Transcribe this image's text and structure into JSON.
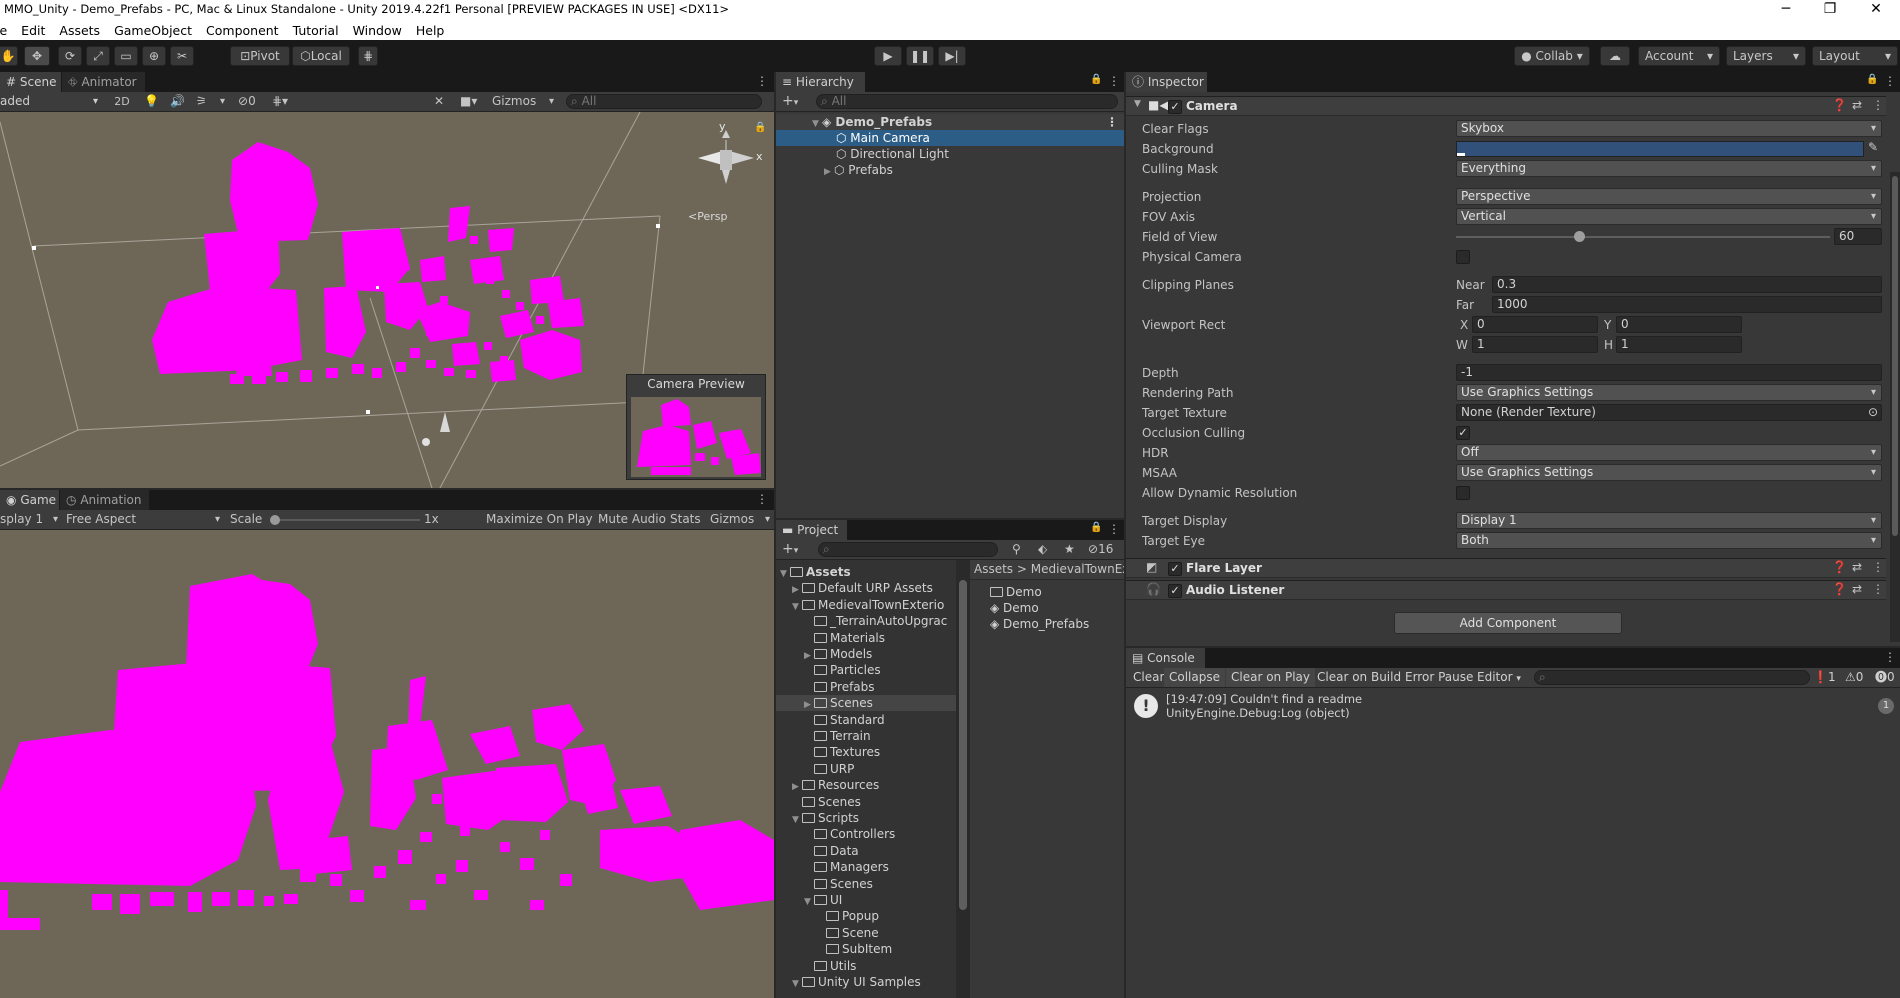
{
  "window": {
    "title": "MMO_Unity - Demo_Prefabs - PC, Mac & Linux Standalone - Unity 2019.4.22f1 Personal [PREVIEW PACKAGES IN USE] <DX11>"
  },
  "menu": [
    "le",
    "Edit",
    "Assets",
    "GameObject",
    "Component",
    "Tutorial",
    "Window",
    "Help"
  ],
  "toolbar": {
    "pivot": "Pivot",
    "local": "Local",
    "collab": "Collab",
    "account": "Account",
    "layers": "Layers",
    "layout": "Layout"
  },
  "scene": {
    "tab_scene": "Scene",
    "tab_animator": "Animator",
    "shading": "aded",
    "mode_2d": "2D",
    "hidden_count": "0",
    "gizmos": "Gizmos",
    "search_placeholder": "All",
    "axis_y": "y",
    "axis_x": "x",
    "persp": "Persp",
    "camera_preview": "Camera Preview"
  },
  "game": {
    "tab_game": "Game",
    "tab_animation": "Animation",
    "display": "splay 1",
    "aspect": "Free Aspect",
    "scale_label": "Scale",
    "scale_value": "1x",
    "maximize": "Maximize On Play",
    "mute": "Mute Audio",
    "stats": "Stats",
    "gizmos": "Gizmos"
  },
  "hierarchy": {
    "tab": "Hierarchy",
    "search_placeholder": "All",
    "scene_name": "Demo_Prefabs",
    "items": [
      "Main Camera",
      "Directional Light",
      "Prefabs"
    ]
  },
  "project": {
    "tab": "Project",
    "hidden_count": "16",
    "breadcrumb_root": "Assets",
    "breadcrumb_sep": ">",
    "breadcrumb_child": "MedievalTownExte",
    "tree": [
      {
        "label": "Assets",
        "depth": 0,
        "expanded": true,
        "bold": true
      },
      {
        "label": "Default URP Assets",
        "depth": 1,
        "expanded": false
      },
      {
        "label": "MedievalTownExterio",
        "depth": 1,
        "expanded": true
      },
      {
        "label": "_TerrainAutoUpgrac",
        "depth": 2,
        "expanded": null
      },
      {
        "label": "Materials",
        "depth": 2,
        "expanded": null
      },
      {
        "label": "Models",
        "depth": 2,
        "expanded": false
      },
      {
        "label": "Particles",
        "depth": 2,
        "expanded": null
      },
      {
        "label": "Prefabs",
        "depth": 2,
        "expanded": null
      },
      {
        "label": "Scenes",
        "depth": 2,
        "expanded": false,
        "highlight": true
      },
      {
        "label": "Standard",
        "depth": 2,
        "expanded": null
      },
      {
        "label": "Terrain",
        "depth": 2,
        "expanded": null
      },
      {
        "label": "Textures",
        "depth": 2,
        "expanded": null
      },
      {
        "label": "URP",
        "depth": 2,
        "expanded": null
      },
      {
        "label": "Resources",
        "depth": 1,
        "expanded": false
      },
      {
        "label": "Scenes",
        "depth": 1,
        "expanded": null
      },
      {
        "label": "Scripts",
        "depth": 1,
        "expanded": true
      },
      {
        "label": "Controllers",
        "depth": 2,
        "expanded": null
      },
      {
        "label": "Data",
        "depth": 2,
        "expanded": null
      },
      {
        "label": "Managers",
        "depth": 2,
        "expanded": null
      },
      {
        "label": "Scenes",
        "depth": 2,
        "expanded": null
      },
      {
        "label": "UI",
        "depth": 2,
        "expanded": true
      },
      {
        "label": "Popup",
        "depth": 3,
        "expanded": null
      },
      {
        "label": "Scene",
        "depth": 3,
        "expanded": null
      },
      {
        "label": "SubItem",
        "depth": 3,
        "expanded": null
      },
      {
        "label": "Utils",
        "depth": 2,
        "expanded": null
      },
      {
        "label": "Unity UI Samples",
        "depth": 1,
        "expanded": true
      }
    ],
    "files": [
      {
        "label": "Demo",
        "kind": "folder"
      },
      {
        "label": "Demo",
        "kind": "unity"
      },
      {
        "label": "Demo_Prefabs",
        "kind": "unity"
      }
    ]
  },
  "inspector": {
    "tab": "Inspector",
    "component": "Camera",
    "props": {
      "clear_flags": {
        "label": "Clear Flags",
        "value": "Skybox"
      },
      "background": {
        "label": "Background",
        "color": "#31507a"
      },
      "culling_mask": {
        "label": "Culling Mask",
        "value": "Everything"
      },
      "projection": {
        "label": "Projection",
        "value": "Perspective"
      },
      "fov_axis": {
        "label": "FOV Axis",
        "value": "Vertical"
      },
      "fov": {
        "label": "Field of View",
        "value": "60",
        "fraction": 0.33
      },
      "physical": {
        "label": "Physical Camera"
      },
      "clipping": {
        "label": "Clipping Planes",
        "near_label": "Near",
        "near": "0.3",
        "far_label": "Far",
        "far": "1000"
      },
      "viewport": {
        "label": "Viewport Rect",
        "x_label": "X",
        "x": "0",
        "y_label": "Y",
        "y": "0",
        "w_label": "W",
        "w": "1",
        "h_label": "H",
        "h": "1"
      },
      "depth": {
        "label": "Depth",
        "value": "-1"
      },
      "rendering_path": {
        "label": "Rendering Path",
        "value": "Use Graphics Settings"
      },
      "target_texture": {
        "label": "Target Texture",
        "value": "None (Render Texture)"
      },
      "occlusion": {
        "label": "Occlusion Culling"
      },
      "hdr": {
        "label": "HDR",
        "value": "Off"
      },
      "msaa": {
        "label": "MSAA",
        "value": "Use Graphics Settings"
      },
      "dynamic_res": {
        "label": "Allow Dynamic Resolution"
      },
      "target_display": {
        "label": "Target Display",
        "value": "Display 1"
      },
      "target_eye": {
        "label": "Target Eye",
        "value": "Both"
      }
    },
    "flare_layer": "Flare Layer",
    "audio_listener": "Audio Listener",
    "add_component": "Add Component"
  },
  "console": {
    "tab": "Console",
    "buttons": [
      "Clear",
      "Collapse",
      "Clear on Play",
      "Clear on Build",
      "Error Pause",
      "Editor"
    ],
    "count_log": "1",
    "count_warn": "0",
    "count_err": "0",
    "entry_line1": "[19:47:09] Couldn't find a readme",
    "entry_line2": "UnityEngine.Debug:Log (object)",
    "entry_count": "1"
  }
}
